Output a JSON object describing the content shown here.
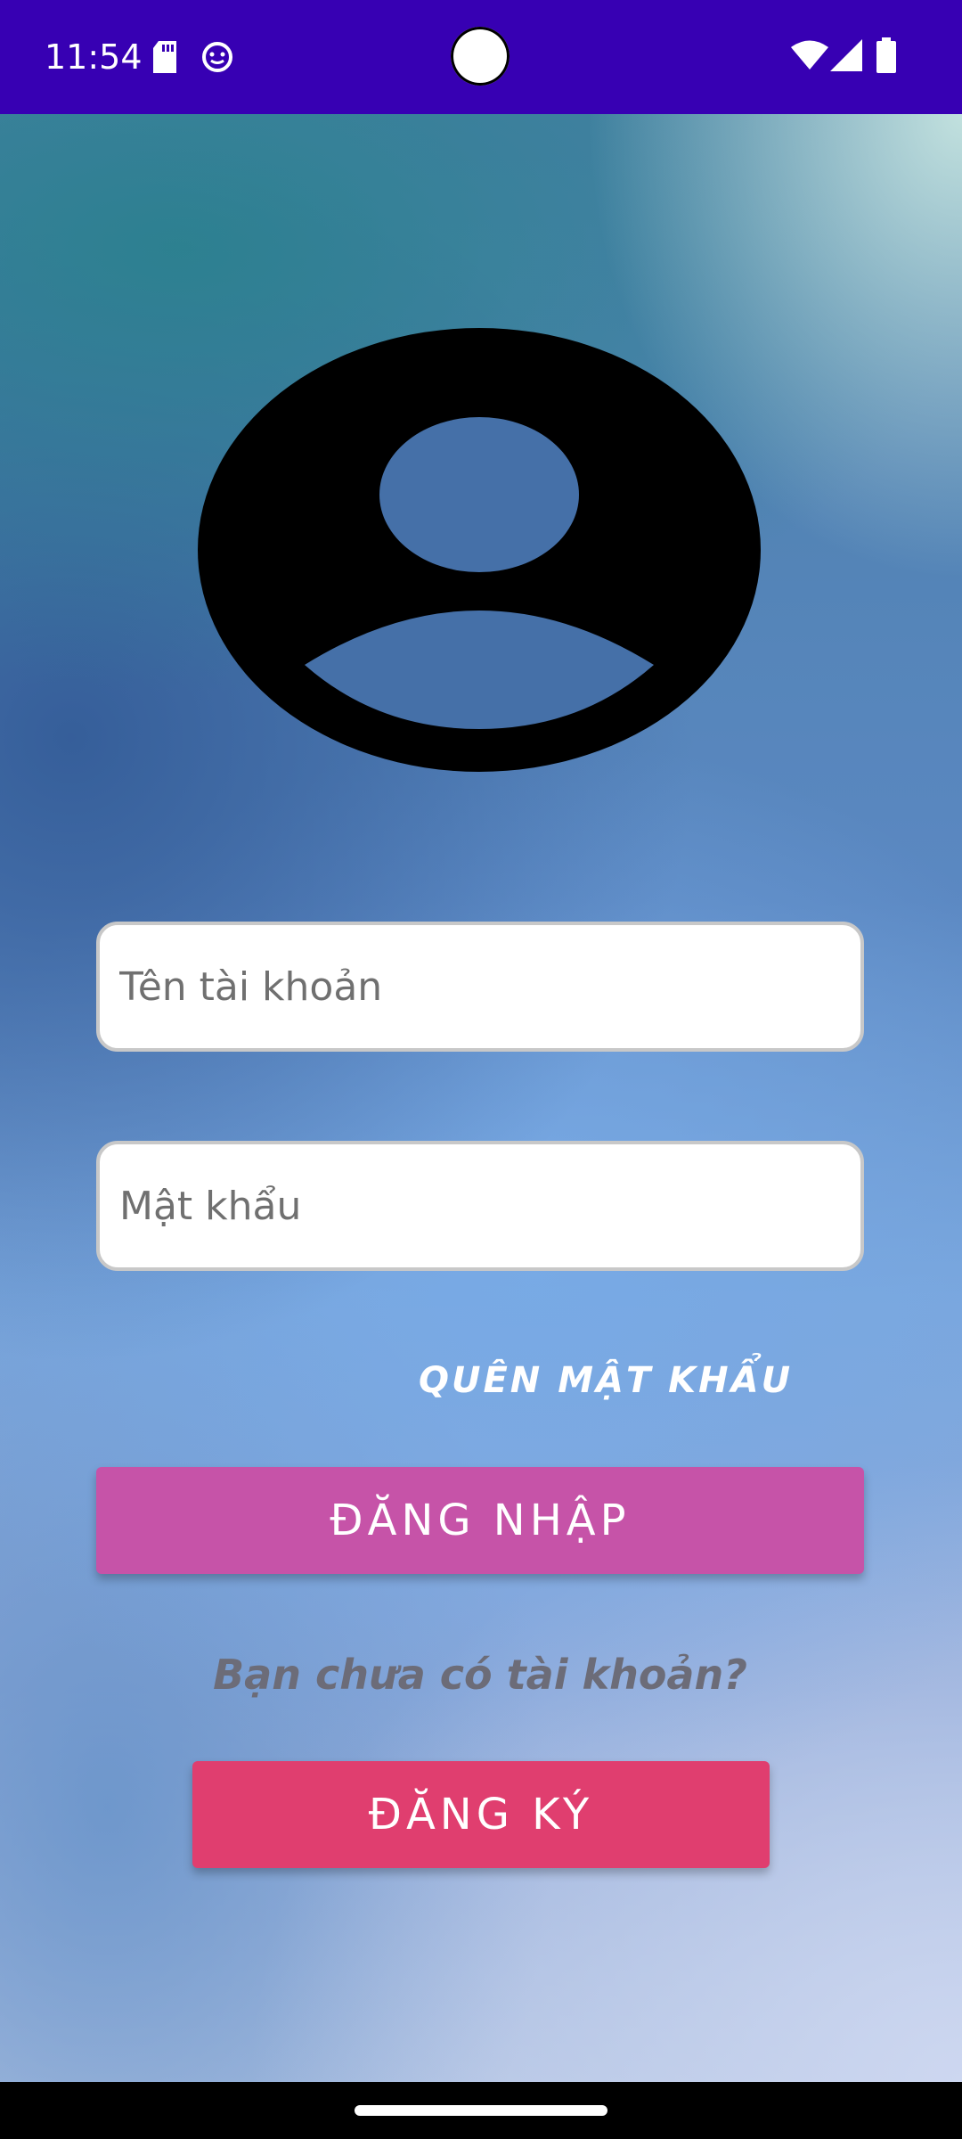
{
  "status_bar": {
    "time": "11:54",
    "icons": [
      "sd-card-icon",
      "notification-face-icon",
      "wifi-icon",
      "cellular-signal-icon",
      "battery-icon"
    ],
    "background_color": "#3700b3"
  },
  "login": {
    "avatar_icon": "account-circle-icon",
    "username_placeholder": "Tên tài khoản",
    "password_placeholder": "Mật khẩu",
    "forgot_password": "QUÊN MẬT KHẨU",
    "login_button": "ĐĂNG NHẬP",
    "no_account_text": "Bạn chưa có tài khoản?",
    "register_button": "ĐĂNG KÝ"
  },
  "colors": {
    "login_button": "#c653a8",
    "register_button": "#e03e6f",
    "no_account_text": "#6c6c78"
  }
}
